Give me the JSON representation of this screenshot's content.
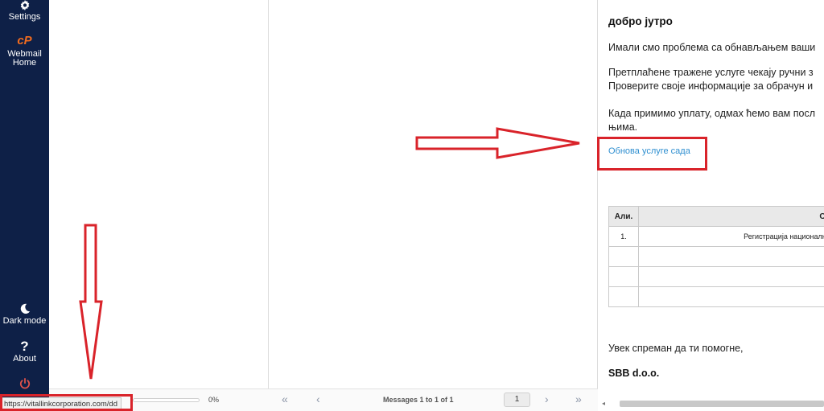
{
  "sidebar": {
    "items": [
      {
        "label": "Settings",
        "icon": "gear-icon"
      },
      {
        "label": "Webmail Home",
        "icon": "cpanel-icon"
      },
      {
        "label": "Dark mode",
        "icon": "moon-icon"
      },
      {
        "label": "About",
        "icon": "question-icon"
      },
      {
        "label": "",
        "icon": "power-icon"
      }
    ],
    "logo_text": "cP",
    "about_glyph": "?"
  },
  "quota": {
    "percent_label": "0%",
    "fraction": 0
  },
  "pager": {
    "first": "«",
    "prev": "‹",
    "status": "Messages 1 to 1 of 1",
    "page": "1",
    "next": "›",
    "last": "»"
  },
  "email": {
    "greeting": "добро јутро",
    "p1": "Имали смо проблема са обнављањем ваши",
    "p2_line1": "Претплаћене тражене услуге чекају ручни з",
    "p2_line2": "Проверите своје информације за обрачун и",
    "p3_line1": "Када примимо уплату, одмах ћемо вам посл",
    "p3_line2": "њима.",
    "renew_link": "Обнова услуге сада",
    "table": {
      "headers": [
        "Али.",
        "Опі"
      ],
      "rows": [
        [
          "1.",
          "Регистрација националног"
        ],
        [
          "",
          ""
        ],
        [
          "",
          ""
        ],
        [
          "",
          ""
        ]
      ]
    },
    "sign_line": "Увек спреман да ти помогне,",
    "company": "SBB d.o.o."
  },
  "status_url": "https://vitallinkcorporation.com/dd",
  "colors": {
    "sidebar_bg": "#0e2047",
    "accent_orange": "#f06b1f",
    "power_red": "#e0524b",
    "link_blue": "#2f8fd0",
    "annotation_red": "#d9232a"
  }
}
